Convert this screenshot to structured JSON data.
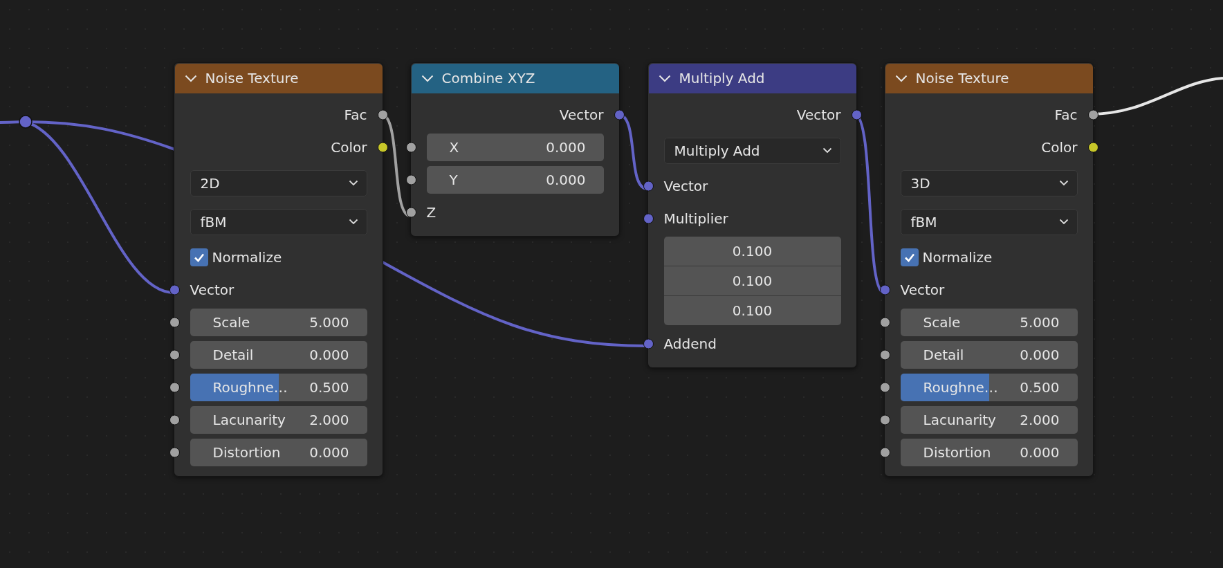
{
  "nodes": [
    {
      "title": "Noise Texture",
      "color": "#7b4a1f",
      "rows": [
        {
          "kind": "output",
          "label": "Fac",
          "color": "#a1a1a1"
        },
        {
          "kind": "output",
          "label": "Color",
          "color": "#c7c729"
        },
        {
          "kind": "dropdown",
          "value": "2D"
        },
        {
          "kind": "dropdown",
          "value": "fBM"
        },
        {
          "kind": "checkbox",
          "label": "Normalize",
          "checked": true
        },
        {
          "kind": "input",
          "label": "Vector",
          "color": "#6363c7"
        },
        {
          "kind": "field",
          "label": "Scale",
          "value": "5.000",
          "color": "#a1a1a1"
        },
        {
          "kind": "field",
          "label": "Detail",
          "value": "0.000",
          "color": "#a1a1a1"
        },
        {
          "kind": "field",
          "label": "Roughne…",
          "value": "0.500",
          "color": "#a1a1a1",
          "level": 0.5
        },
        {
          "kind": "field",
          "label": "Lacunarity",
          "value": "2.000",
          "color": "#a1a1a1"
        },
        {
          "kind": "field",
          "label": "Distortion",
          "value": "0.000",
          "color": "#a1a1a1"
        }
      ]
    },
    {
      "title": "Combine XYZ",
      "color": "#246283",
      "rows": [
        {
          "kind": "output",
          "label": "Vector",
          "color": "#6363c7"
        },
        {
          "kind": "field",
          "label": "X",
          "value": "0.000",
          "color": "#a1a1a1"
        },
        {
          "kind": "field",
          "label": "Y",
          "value": "0.000",
          "color": "#a1a1a1"
        },
        {
          "kind": "input",
          "label": "Z",
          "color": "#a1a1a1"
        }
      ]
    },
    {
      "title": "Multiply Add",
      "color": "#3c3c83",
      "rows": [
        {
          "kind": "output",
          "label": "Vector",
          "color": "#6363c7"
        },
        {
          "kind": "dropdown",
          "value": "Multiply Add"
        },
        {
          "kind": "input",
          "label": "Vector",
          "color": "#6363c7"
        },
        {
          "kind": "input",
          "label": "Multiplier",
          "color": "#6363c7"
        },
        {
          "kind": "vector",
          "values": [
            "0.100",
            "0.100",
            "0.100"
          ]
        },
        {
          "kind": "input",
          "label": "Addend",
          "color": "#6363c7"
        }
      ]
    },
    {
      "title": "Noise Texture",
      "color": "#7b4a1f",
      "rows": [
        {
          "kind": "output",
          "label": "Fac",
          "color": "#a1a1a1"
        },
        {
          "kind": "output",
          "label": "Color",
          "color": "#c7c729"
        },
        {
          "kind": "dropdown",
          "value": "3D"
        },
        {
          "kind": "dropdown",
          "value": "fBM"
        },
        {
          "kind": "checkbox",
          "label": "Normalize",
          "checked": true
        },
        {
          "kind": "input",
          "label": "Vector",
          "color": "#6363c7"
        },
        {
          "kind": "field",
          "label": "Scale",
          "value": "5.000",
          "color": "#a1a1a1"
        },
        {
          "kind": "field",
          "label": "Detail",
          "value": "0.000",
          "color": "#a1a1a1"
        },
        {
          "kind": "field",
          "label": "Roughne…",
          "value": "0.500",
          "color": "#a1a1a1",
          "level": 0.5
        },
        {
          "kind": "field",
          "label": "Lacunarity",
          "value": "2.000",
          "color": "#a1a1a1"
        },
        {
          "kind": "field",
          "label": "Distortion",
          "value": "0.000",
          "color": "#a1a1a1"
        }
      ]
    }
  ]
}
